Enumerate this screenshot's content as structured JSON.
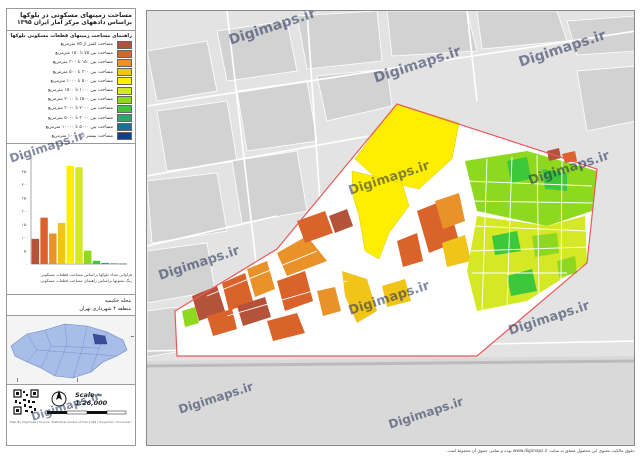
{
  "title": {
    "line1": "مساحت زمینهای مسکونی در بلوکها",
    "line2": "براساس دادههای مرکز آمار ایران ۱۳۹۵"
  },
  "legend": {
    "heading": "راهنمای مساحت زمینهای قطعات مسکونی بلوکها",
    "items": [
      {
        "label": "مساحت کمتر از ۷۵ مترمربع",
        "color": "#b5533a"
      },
      {
        "label": "مساحت بین ۷۵ تا ۱۵۰ مترمربع",
        "color": "#d9632b"
      },
      {
        "label": "مساحت بین ۱۵۰ تا ۳۰۰ مترمربع",
        "color": "#e9922a"
      },
      {
        "label": "مساحت بین ۳۰۰ تا ۵۰۰ مترمربع",
        "color": "#f0c419"
      },
      {
        "label": "مساحت بین ۵۰۰ تا ۱۰۰۰ مترمربع",
        "color": "#ffee00"
      },
      {
        "label": "مساحت بین ۱۰۰۰ تا ۱۵۰۰ مترمربع",
        "color": "#d4e826"
      },
      {
        "label": "مساحت بین ۱۵۰۰ تا ۲۰۰۰ مترمربع",
        "color": "#8ed81f"
      },
      {
        "label": "مساحت بین ۲۰۰۰ تا ۳۰۰۰ مترمربع",
        "color": "#3cc83a"
      },
      {
        "label": "مساحت بین ۳۰۰۰ تا ۵۰۰۰ مترمربع",
        "color": "#2fa46e"
      },
      {
        "label": "مساحت بین ۵۰۰۰ تا ۱۰۰۰۰ مترمربع",
        "color": "#1f6e9a"
      },
      {
        "label": "مساحت بیشتر از ۱۰۰۰۰ مترمربع",
        "color": "#0f3f8a"
      }
    ]
  },
  "chart_data": {
    "type": "bar",
    "categories": [
      "۱",
      "۲",
      "۳",
      "۴",
      "۵",
      "۶",
      "۷",
      "۸",
      "۹",
      "۱۰",
      "۱۱"
    ],
    "values": [
      95,
      175,
      115,
      155,
      370,
      365,
      50,
      12,
      4,
      2,
      1
    ],
    "colors": [
      "#b5533a",
      "#d9632b",
      "#e9922a",
      "#f0c419",
      "#ffee00",
      "#d4e826",
      "#8ed81f",
      "#3cc83a",
      "#2fa46e",
      "#1f6e9a",
      "#0f3f8a"
    ],
    "ylim": [
      0,
      400
    ],
    "ytick_labels": [
      "۴۰۰",
      "۳۵۰",
      "۳۰۰",
      "۲۵۰",
      "۲۰۰",
      "۱۵۰",
      "۱۰۰",
      "۵۰",
      "۰"
    ],
    "caption_line1": "فراوانی تعداد بلوکها براساس مساحت قطعات مسکونی",
    "caption_line2": "رنگ ستونها براساس راهنمای مساحت قطعات مسکونی",
    "grid": false
  },
  "locator": {
    "line1": "محله حکیمیه",
    "line2": "منطقه ۴ شهرداری تهران"
  },
  "scale": {
    "text": "Scale = 1:26,000",
    "north_label": "N"
  },
  "watermark_text": "Digimaps.ir",
  "credit": "Map By Digimaps | Source: Statistical Centre of Iran 1395 | Projection: Universal Transverse Mercator",
  "footer": "حقوق مالکیت معنوی این محصول متعلق به سایت www.digimaps.ir بوده و تمامی حقوق آن محفوظ است.",
  "colors": {
    "boundary": "#e85a5a",
    "background": "#e6e6e6",
    "roads": "#ffffff",
    "buildings": "#cfcfcf"
  }
}
